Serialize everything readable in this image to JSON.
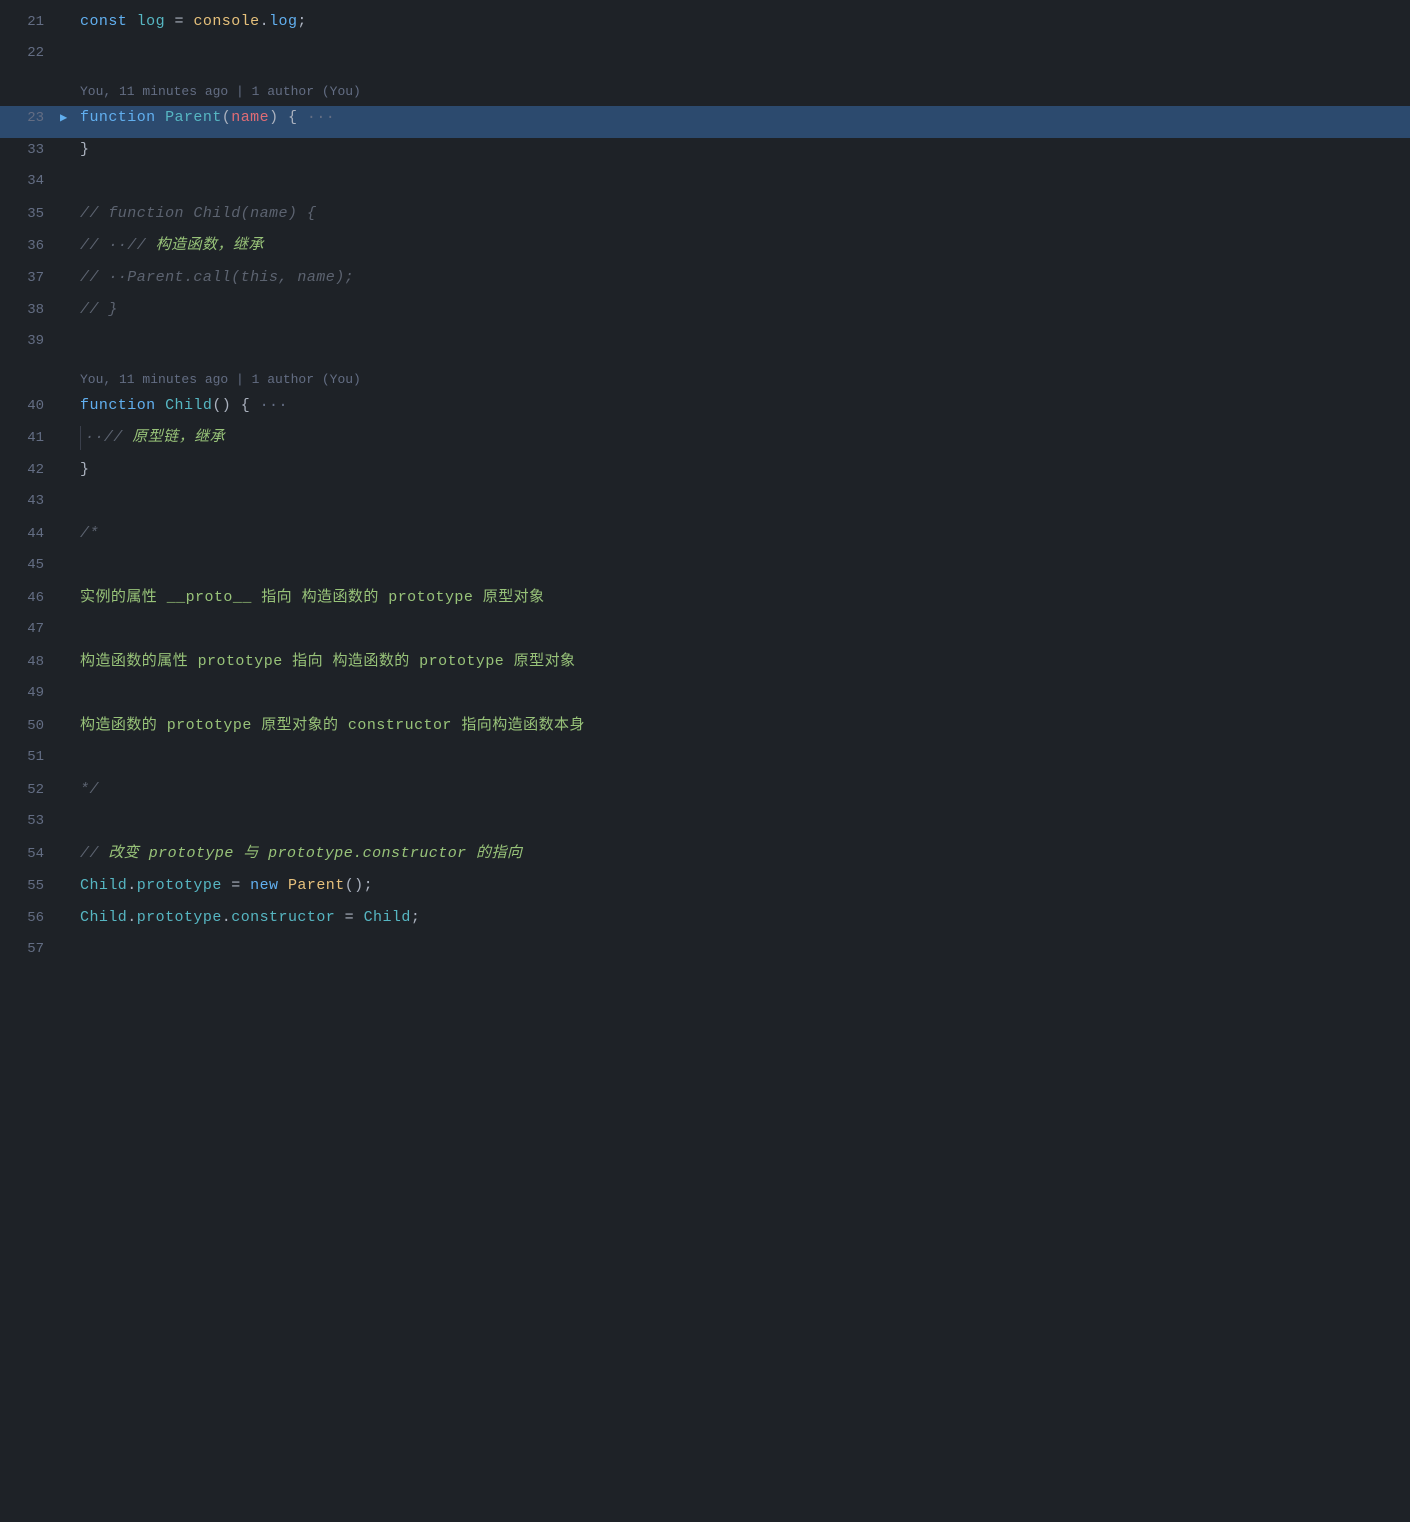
{
  "editor": {
    "background": "#1e2227",
    "lines": [
      {
        "number": "21",
        "highlighted": false,
        "foldArrow": "",
        "content": "<span class=\"kw\">const</span><span class=\"punct\"> </span><span class=\"var\">log</span><span class=\"punct\"> = </span><span class=\"obj\">console</span><span class=\"punct\">.</span><span class=\"method\">log</span><span class=\"punct\">;</span>"
      },
      {
        "number": "22",
        "highlighted": false,
        "foldArrow": "",
        "content": ""
      },
      {
        "blame": "You, 11 minutes ago | 1 author (You)"
      },
      {
        "number": "23",
        "highlighted": true,
        "foldArrow": "▶",
        "content": "<span class=\"kw\">function</span><span class=\"punct\"> </span><span class=\"fn-name\">Parent</span><span class=\"punct\">(</span><span class=\"param\">name</span><span class=\"punct\">) {</span><span class=\"dots\"> ···</span>"
      },
      {
        "number": "33",
        "highlighted": false,
        "foldArrow": "",
        "content": "<span class=\"punct\">}</span>"
      },
      {
        "number": "34",
        "highlighted": false,
        "foldArrow": "",
        "content": ""
      },
      {
        "number": "35",
        "highlighted": false,
        "foldArrow": "",
        "content": "<span class=\"comment\">// function Child(name) {</span>"
      },
      {
        "number": "36",
        "highlighted": false,
        "foldArrow": "",
        "content": "<span class=\"comment\">// ··// <span class=\"chinese-comment\">构造函数，继承</span></span>"
      },
      {
        "number": "37",
        "highlighted": false,
        "foldArrow": "",
        "content": "<span class=\"comment\">// ··Parent.call(this, name);</span>"
      },
      {
        "number": "38",
        "highlighted": false,
        "foldArrow": "",
        "content": "<span class=\"comment\">// }</span>"
      },
      {
        "number": "39",
        "highlighted": false,
        "foldArrow": "",
        "content": ""
      },
      {
        "blame": "You, 11 minutes ago | 1 author (You)"
      },
      {
        "number": "40",
        "highlighted": false,
        "foldArrow": "",
        "content": "<span class=\"kw\">function</span><span class=\"punct\"> </span><span class=\"fn-name\">Child</span><span class=\"punct\">() {</span><span class=\"dots\"> ···</span>"
      },
      {
        "number": "41",
        "highlighted": false,
        "foldArrow": "",
        "indent": true,
        "content": "<span class=\"comment\">··// <span class=\"chinese-comment\">原型链，继承</span></span>"
      },
      {
        "number": "42",
        "highlighted": false,
        "foldArrow": "",
        "content": "<span class=\"punct\">}</span>"
      },
      {
        "number": "43",
        "highlighted": false,
        "foldArrow": "",
        "content": ""
      },
      {
        "number": "44",
        "highlighted": false,
        "foldArrow": "",
        "content": "<span class=\"comment\">/*</span>"
      },
      {
        "number": "45",
        "highlighted": false,
        "foldArrow": "",
        "content": ""
      },
      {
        "number": "46",
        "highlighted": false,
        "foldArrow": "",
        "content": "<span class=\"chinese-comment\">实例的属性 __proto__ 指向 构造函数的 prototype 原型对象</span>"
      },
      {
        "number": "47",
        "highlighted": false,
        "foldArrow": "",
        "content": ""
      },
      {
        "number": "48",
        "highlighted": false,
        "foldArrow": "",
        "content": "<span class=\"chinese-comment\">构造函数的属性 prototype 指向 构造函数的 prototype 原型对象</span>"
      },
      {
        "number": "49",
        "highlighted": false,
        "foldArrow": "",
        "content": ""
      },
      {
        "number": "50",
        "highlighted": false,
        "foldArrow": "",
        "content": "<span class=\"chinese-comment\">构造函数的 prototype 原型对象的 constructor 指向构造函数本身</span>"
      },
      {
        "number": "51",
        "highlighted": false,
        "foldArrow": "",
        "content": ""
      },
      {
        "number": "52",
        "highlighted": false,
        "foldArrow": "",
        "content": "<span class=\"comment\">*/</span>"
      },
      {
        "number": "53",
        "highlighted": false,
        "foldArrow": "",
        "content": ""
      },
      {
        "number": "54",
        "highlighted": false,
        "foldArrow": "",
        "content": "<span class=\"comment\">// <span class=\"chinese-comment\">改变 prototype 与 prototype.constructor 的指向</span></span>"
      },
      {
        "number": "55",
        "highlighted": false,
        "foldArrow": "",
        "content": "<span class=\"fn-name\">Child</span><span class=\"punct\">.</span><span class=\"proto\">prototype</span><span class=\"punct\"> = </span><span class=\"kw\">new</span><span class=\"punct\"> </span><span class=\"constructor-name\">Parent</span><span class=\"punct\">();</span>"
      },
      {
        "number": "56",
        "highlighted": false,
        "foldArrow": "",
        "content": "<span class=\"fn-name\">Child</span><span class=\"punct\">.</span><span class=\"proto\">prototype</span><span class=\"punct\">.</span><span class=\"proto\">constructor</span><span class=\"punct\"> = </span><span class=\"fn-name\">Child</span><span class=\"punct\">;</span>"
      },
      {
        "number": "57",
        "highlighted": false,
        "foldArrow": "",
        "content": ""
      }
    ]
  }
}
